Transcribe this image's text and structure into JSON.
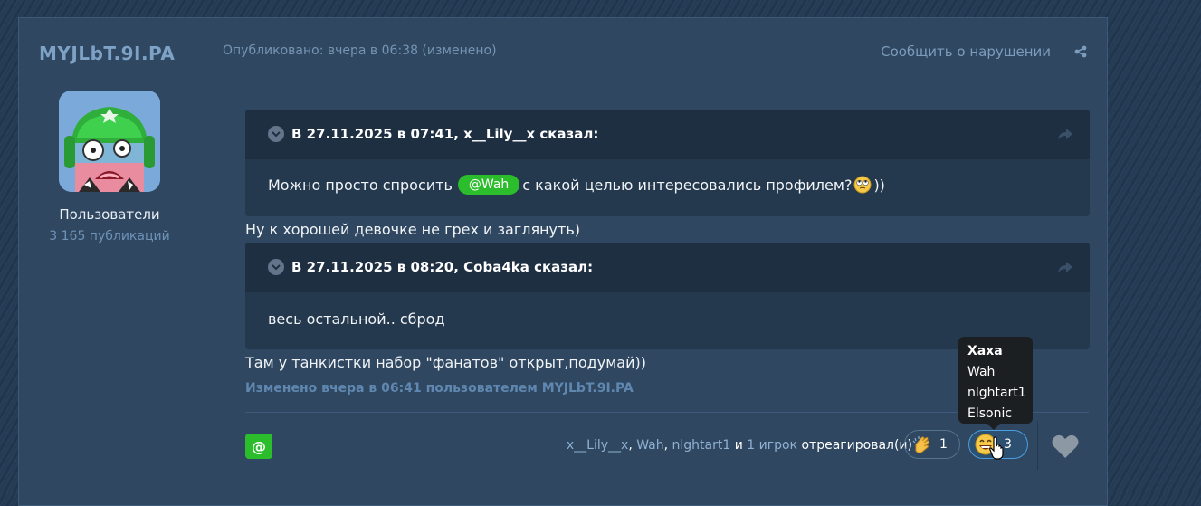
{
  "author": {
    "name": "MYJLbT.9I.PA",
    "group": "Пользователи",
    "post_count": "3 165 публикаций"
  },
  "post": {
    "meta": "Опубликовано: вчера в 06:38 (изменено)",
    "report_label": "Сообщить о нарушении",
    "quote1": {
      "title": "В 27.11.2025 в 07:41, x__Lily__x сказал:",
      "text_before": "Можно просто спросить",
      "mention": "@Wah",
      "text_after": "с какой целью интересовались профилем?",
      "text_end": "))"
    },
    "reply1": "Ну к хорошей девочке не грех и заглянуть)",
    "quote2": {
      "title": "В 27.11.2025 в 08:20, Coba4ka сказал:",
      "text": "весь остальной.. сброд"
    },
    "reply2": "Там у танкистки набор \"фанатов\" открыт,подумай))",
    "edit_note": "Изменено вчера в 06:41 пользователем MYJLbT.9I.PA"
  },
  "footer": {
    "mention_button": "@",
    "reactors": {
      "names": [
        "x__Lily__x",
        "Wah",
        "nlghtart1"
      ],
      "sep1": ",",
      "sep2": ",",
      "and_word": "и",
      "more": "1 игрок",
      "suffix": "отреагировал(и)"
    },
    "reactions": [
      {
        "icon": "clap-emoji-icon",
        "count": "1"
      },
      {
        "icon": "laugh-emoji-icon",
        "count": "3"
      }
    ]
  },
  "tooltip": {
    "title": "Хаха",
    "users": [
      "Wah",
      "nlghtart1",
      "Elsonic"
    ]
  },
  "colors": {
    "accent_green": "#2bbd2b",
    "link_blue": "#8fb0d2",
    "panel": "#2f4760"
  }
}
